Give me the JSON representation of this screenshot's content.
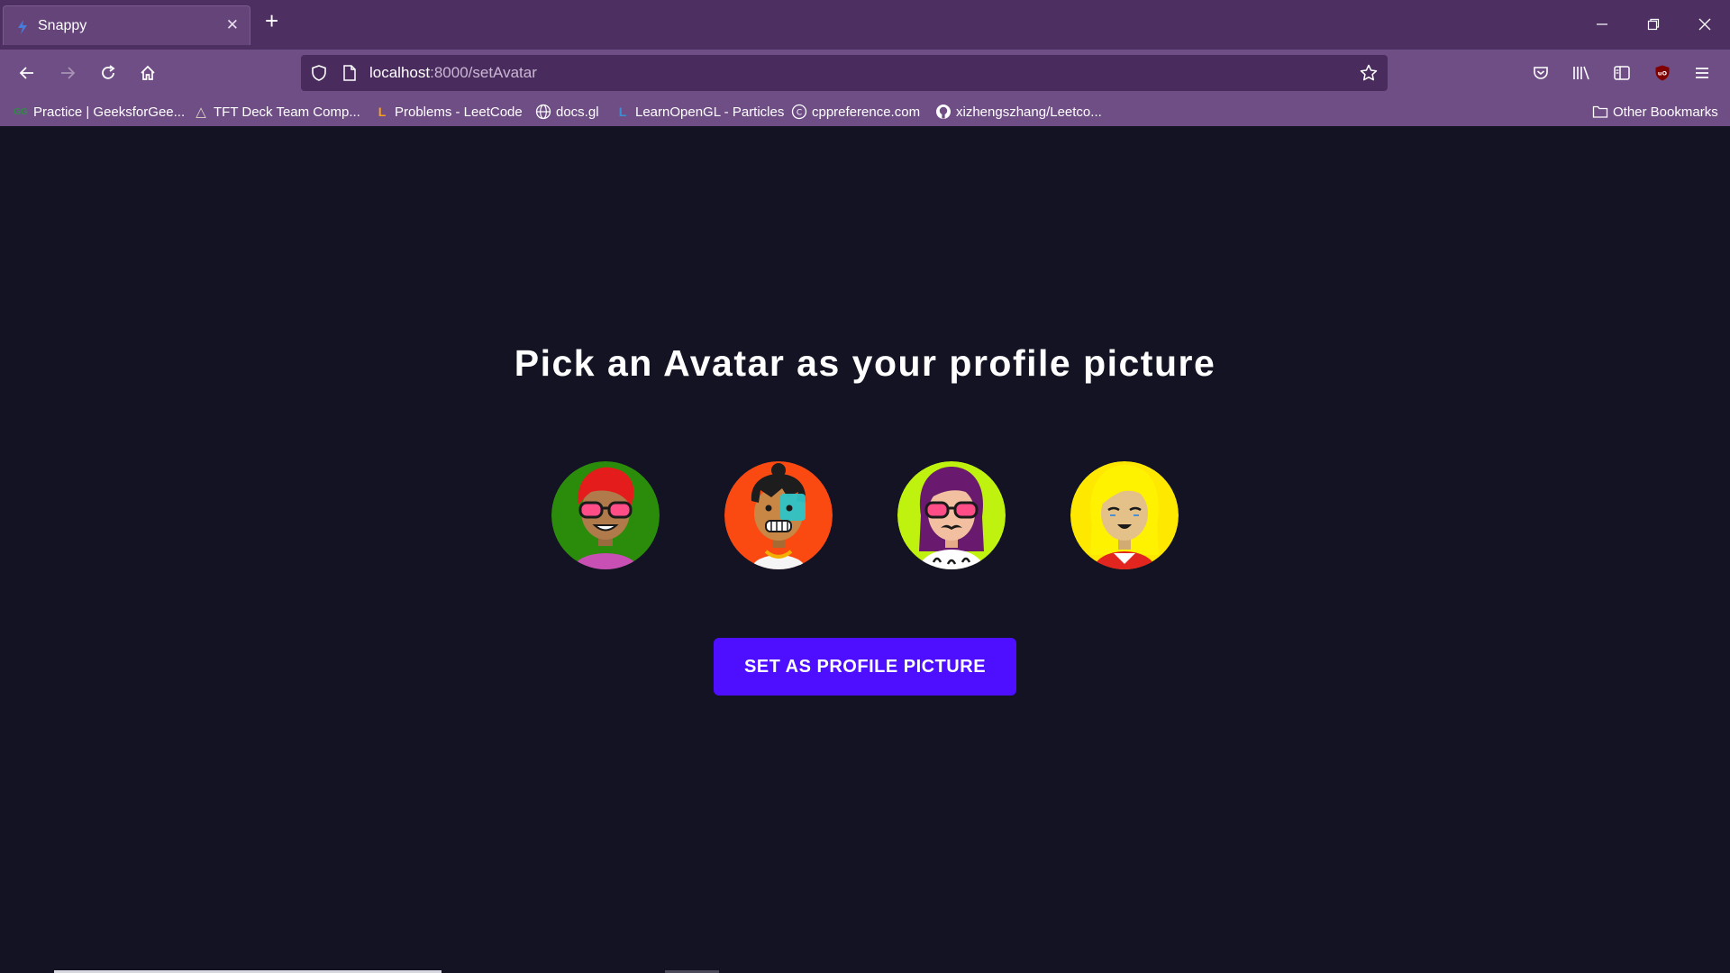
{
  "tab": {
    "title": "Snappy",
    "close": "✕"
  },
  "newtab": {
    "label": "+"
  },
  "address": {
    "host": "localhost",
    "path": ":8000/setAvatar"
  },
  "bookmarks": [
    {
      "label": "Practice | GeeksforGee...",
      "icon": "GG",
      "color": "#2f8d46"
    },
    {
      "label": "TFT Deck Team Comp...",
      "icon": "△",
      "color": "#e3d8c7"
    },
    {
      "label": "Problems - LeetCode",
      "icon": "L",
      "color": "#f89f1b"
    },
    {
      "label": "docs.gl",
      "icon": "globe-icon",
      "color": "#ffffff"
    },
    {
      "label": "LearnOpenGL - Particles",
      "icon": "L",
      "color": "#3b8ed4"
    },
    {
      "label": "cppreference.com",
      "icon": "C",
      "color": "#ffffff"
    },
    {
      "label": "xizhengszhang/Leetco...",
      "icon": "github-icon",
      "color": "#ffffff"
    }
  ],
  "other_bookmarks": {
    "label": "Other Bookmarks"
  },
  "main": {
    "heading": "Pick an Avatar as your profile picture",
    "button_label": "SET AS PROFILE PICTURE",
    "avatars": [
      {
        "name": "avatar-1",
        "bg": "#2b8c0c",
        "hair": "#e51c1c",
        "skin": "#b07a4b",
        "shirt": "#c84fb4"
      },
      {
        "name": "avatar-2",
        "bg": "#fa4a12",
        "hair": "#1d1d1d",
        "skin": "#c98746",
        "shirt": "#f5f5f5"
      },
      {
        "name": "avatar-3",
        "bg": "#bff20e",
        "hair": "#6a1a6e",
        "skin": "#f2c0a0",
        "shirt": "#ffffff"
      },
      {
        "name": "avatar-4",
        "bg": "#ffe800",
        "hair": "#fff200",
        "skin": "#e4c189",
        "shirt": "#e2261f"
      }
    ]
  },
  "colors": {
    "accent": "#4e0eff",
    "page_bg": "#131324",
    "chrome": "#4e2f62",
    "toolbar": "#6f4e85"
  }
}
